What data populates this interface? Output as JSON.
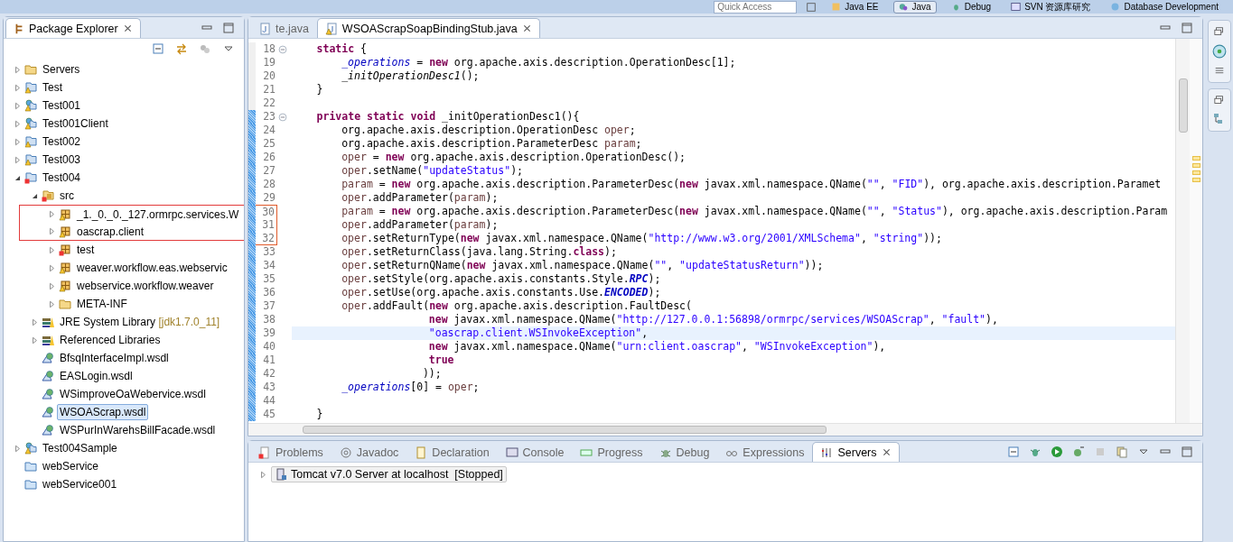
{
  "toolbar": {
    "quick_access": {
      "placeholder": "Quick Access"
    },
    "perspectives": [
      {
        "label": "Java EE",
        "selected": false,
        "kind": "jee"
      },
      {
        "label": "Java",
        "selected": true,
        "kind": "java"
      },
      {
        "label": "Debug",
        "selected": false,
        "kind": "debug"
      },
      {
        "label": "SVN 资源库研究",
        "selected": false,
        "kind": "svn"
      },
      {
        "label": "Database Development",
        "selected": false,
        "kind": "db"
      }
    ]
  },
  "explorer": {
    "title": "Package Explorer",
    "tree": [
      {
        "label": "Servers",
        "kind": "folder",
        "expanded": false,
        "boxed": false,
        "selected": false
      },
      {
        "label": "Test",
        "kind": "project",
        "expanded": false,
        "boxed": false,
        "selected": false
      },
      {
        "label": "Test001",
        "kind": "webproject",
        "expanded": false,
        "boxed": false,
        "selected": false
      },
      {
        "label": "Test001Client",
        "kind": "webproject",
        "expanded": false,
        "boxed": false,
        "selected": false
      },
      {
        "label": "Test002",
        "kind": "project",
        "expanded": false,
        "boxed": false,
        "selected": false
      },
      {
        "label": "Test003",
        "kind": "project",
        "expanded": false,
        "boxed": false,
        "selected": false
      },
      {
        "label": "Test004",
        "kind": "errproject",
        "expanded": true,
        "boxed": false,
        "selected": false,
        "children": [
          {
            "label": "src",
            "kind": "src",
            "expanded": true,
            "boxed": false,
            "selected": false,
            "children": [
              {
                "label": "_1._0._0._127.ormrpc.services.W",
                "kind": "package",
                "expanded": false,
                "boxed": true,
                "selected": false
              },
              {
                "label": "oascrap.client",
                "kind": "package",
                "expanded": false,
                "boxed": true,
                "selected": false
              },
              {
                "label": "test",
                "kind": "errpackage",
                "expanded": false,
                "boxed": false,
                "selected": false
              },
              {
                "label": "weaver.workflow.eas.webservic",
                "kind": "package",
                "expanded": false,
                "boxed": false,
                "selected": false
              },
              {
                "label": "webservice.workflow.weaver",
                "kind": "package",
                "expanded": false,
                "boxed": false,
                "selected": false
              },
              {
                "label": "META-INF",
                "kind": "folder",
                "expanded": false,
                "boxed": false,
                "selected": false
              }
            ]
          },
          {
            "label": "JRE System Library",
            "detail": "[jdk1.7.0_11]",
            "kind": "library",
            "expanded": false,
            "boxed": false,
            "selected": false
          },
          {
            "label": "Referenced Libraries",
            "kind": "library",
            "expanded": false,
            "boxed": false,
            "selected": false
          },
          {
            "label": "BfsqInterfaceImpl.wsdl",
            "kind": "wsdl",
            "boxed": false,
            "selected": false
          },
          {
            "label": "EASLogin.wsdl",
            "kind": "wsdl",
            "boxed": false,
            "selected": false
          },
          {
            "label": "WSimproveOaWebervice.wsdl",
            "kind": "wsdl",
            "boxed": false,
            "selected": false
          },
          {
            "label": "WSOAScrap.wsdl",
            "kind": "wsdl",
            "boxed": false,
            "selected": true
          },
          {
            "label": "WSPurInWarehsBillFacade.wsdl",
            "kind": "wsdl",
            "boxed": false,
            "selected": false
          }
        ]
      },
      {
        "label": "Test004Sample",
        "kind": "webproject",
        "expanded": false,
        "boxed": false,
        "selected": false
      },
      {
        "label": "webService",
        "kind": "plainfolder",
        "boxed": false,
        "selected": false
      },
      {
        "label": "webService001",
        "kind": "plainfolder",
        "boxed": false,
        "selected": false
      }
    ]
  },
  "editor": {
    "tabs": [
      {
        "label": "te.java",
        "selected": false,
        "warning": false
      },
      {
        "label": "WSOAScrapSoapBindingStub.java",
        "selected": true,
        "warning": true
      }
    ],
    "lines": [
      {
        "number": "18",
        "fold": true,
        "changed": false,
        "current": false,
        "boxed": false,
        "kind": "member",
        "tokens": [
          {
            "kind": "kw",
            "text": "static"
          },
          {
            "kind": "p",
            "text": " {"
          }
        ]
      },
      {
        "number": "19",
        "fold": false,
        "changed": false,
        "current": false,
        "boxed": false,
        "kind": "body",
        "tokens": [
          {
            "kind": "f",
            "text": "_operations"
          },
          {
            "kind": "p",
            "text": " = "
          },
          {
            "kind": "kw",
            "text": "new"
          },
          {
            "kind": "p",
            "text": " org.apache.axis.description.OperationDesc[1];"
          }
        ]
      },
      {
        "number": "20",
        "fold": false,
        "changed": false,
        "current": false,
        "boxed": false,
        "kind": "body",
        "tokens": [
          {
            "kind": "m",
            "text": "_initOperationDesc1"
          },
          {
            "kind": "p",
            "text": "();"
          }
        ]
      },
      {
        "number": "21",
        "fold": false,
        "changed": false,
        "current": false,
        "boxed": false,
        "kind": "member",
        "tokens": [
          {
            "kind": "p",
            "text": "}"
          }
        ]
      },
      {
        "number": "22",
        "fold": false,
        "changed": false,
        "current": false,
        "boxed": false,
        "kind": "member"
      },
      {
        "number": "23",
        "fold": true,
        "changed": true,
        "current": false,
        "boxed": false,
        "kind": "member",
        "tokens": [
          {
            "kind": "kw",
            "text": "private"
          },
          {
            "kind": "kw",
            "text": " static"
          },
          {
            "kind": "kw",
            "text": " void"
          },
          {
            "kind": "p",
            "text": " _initOperationDesc1(){"
          }
        ]
      },
      {
        "number": "24",
        "fold": false,
        "changed": true,
        "current": false,
        "boxed": false,
        "kind": "body",
        "tokens": [
          {
            "kind": "p",
            "text": "org.apache.axis.description.OperationDesc "
          },
          {
            "kind": "v",
            "text": "oper"
          },
          {
            "kind": "p",
            "text": ";"
          }
        ]
      },
      {
        "number": "25",
        "fold": false,
        "changed": true,
        "current": false,
        "boxed": false,
        "kind": "body",
        "tokens": [
          {
            "kind": "p",
            "text": "org.apache.axis.description.ParameterDesc "
          },
          {
            "kind": "v",
            "text": "param"
          },
          {
            "kind": "p",
            "text": ";"
          }
        ]
      },
      {
        "number": "26",
        "fold": false,
        "changed": true,
        "current": false,
        "boxed": false,
        "kind": "body",
        "tokens": [
          {
            "kind": "v",
            "text": "oper"
          },
          {
            "kind": "p",
            "text": " = "
          },
          {
            "kind": "kw",
            "text": "new"
          },
          {
            "kind": "p",
            "text": " org.apache.axis.description.OperationDesc();"
          }
        ]
      },
      {
        "number": "27",
        "fold": false,
        "changed": true,
        "current": false,
        "boxed": false,
        "kind": "body",
        "tokens": [
          {
            "kind": "v",
            "text": "oper"
          },
          {
            "kind": "p",
            "text": ".setName("
          },
          {
            "kind": "s",
            "text": "\"updateStatus\""
          },
          {
            "kind": "p",
            "text": ");"
          }
        ]
      },
      {
        "number": "28",
        "fold": false,
        "changed": true,
        "current": false,
        "boxed": false,
        "kind": "body",
        "tokens": [
          {
            "kind": "v",
            "text": "param"
          },
          {
            "kind": "p",
            "text": " = "
          },
          {
            "kind": "kw",
            "text": "new"
          },
          {
            "kind": "p",
            "text": " org.apache.axis.description.ParameterDesc("
          },
          {
            "kind": "kw",
            "text": "new"
          },
          {
            "kind": "p",
            "text": " javax.xml.namespace.QName("
          },
          {
            "kind": "s",
            "text": "\"\""
          },
          {
            "kind": "p",
            "text": ", "
          },
          {
            "kind": "s",
            "text": "\"FID\""
          },
          {
            "kind": "p",
            "text": "), org.apache.axis.description.Paramet"
          }
        ]
      },
      {
        "number": "29",
        "fold": false,
        "changed": true,
        "current": false,
        "boxed": false,
        "kind": "body",
        "tokens": [
          {
            "kind": "v",
            "text": "oper"
          },
          {
            "kind": "p",
            "text": ".addParameter("
          },
          {
            "kind": "v",
            "text": "param"
          },
          {
            "kind": "p",
            "text": ");"
          }
        ]
      },
      {
        "number": "30",
        "fold": false,
        "changed": true,
        "current": false,
        "boxed": true,
        "kind": "body",
        "tokens": [
          {
            "kind": "v",
            "text": "param"
          },
          {
            "kind": "p",
            "text": " = "
          },
          {
            "kind": "kw",
            "text": "new"
          },
          {
            "kind": "p",
            "text": " org.apache.axis.description.ParameterDesc("
          },
          {
            "kind": "kw",
            "text": "new"
          },
          {
            "kind": "p",
            "text": " javax.xml.namespace.QName("
          },
          {
            "kind": "s",
            "text": "\"\""
          },
          {
            "kind": "p",
            "text": ", "
          },
          {
            "kind": "s",
            "text": "\"Status\""
          },
          {
            "kind": "p",
            "text": "), org.apache.axis.description.Param"
          }
        ]
      },
      {
        "number": "31",
        "fold": false,
        "changed": true,
        "current": false,
        "boxed": true,
        "kind": "body",
        "tokens": [
          {
            "kind": "v",
            "text": "oper"
          },
          {
            "kind": "p",
            "text": ".addParameter("
          },
          {
            "kind": "v",
            "text": "param"
          },
          {
            "kind": "p",
            "text": ");"
          }
        ]
      },
      {
        "number": "32",
        "fold": false,
        "changed": true,
        "current": false,
        "boxed": true,
        "kind": "body",
        "tokens": [
          {
            "kind": "v",
            "text": "oper"
          },
          {
            "kind": "p",
            "text": ".setReturnType("
          },
          {
            "kind": "kw",
            "text": "new"
          },
          {
            "kind": "p",
            "text": " javax.xml.namespace.QName("
          },
          {
            "kind": "s",
            "text": "\"http://www.w3.org/2001/XMLSchema\""
          },
          {
            "kind": "p",
            "text": ", "
          },
          {
            "kind": "s",
            "text": "\"string\""
          },
          {
            "kind": "p",
            "text": "));"
          }
        ]
      },
      {
        "number": "33",
        "fold": false,
        "changed": true,
        "current": false,
        "boxed": false,
        "kind": "body",
        "tokens": [
          {
            "kind": "v",
            "text": "oper"
          },
          {
            "kind": "p",
            "text": ".setReturnClass(java.lang.String."
          },
          {
            "kind": "kw",
            "text": "class"
          },
          {
            "kind": "p",
            "text": ");"
          }
        ]
      },
      {
        "number": "34",
        "fold": false,
        "changed": true,
        "current": false,
        "boxed": false,
        "kind": "body",
        "tokens": [
          {
            "kind": "v",
            "text": "oper"
          },
          {
            "kind": "p",
            "text": ".setReturnQName("
          },
          {
            "kind": "kw",
            "text": "new"
          },
          {
            "kind": "p",
            "text": " javax.xml.namespace.QName("
          },
          {
            "kind": "s",
            "text": "\"\""
          },
          {
            "kind": "p",
            "text": ", "
          },
          {
            "kind": "s",
            "text": "\"updateStatusReturn\""
          },
          {
            "kind": "p",
            "text": "));"
          }
        ]
      },
      {
        "number": "35",
        "fold": false,
        "changed": true,
        "current": false,
        "boxed": false,
        "kind": "body",
        "tokens": [
          {
            "kind": "v",
            "text": "oper"
          },
          {
            "kind": "p",
            "text": ".setStyle(org.apache.axis.constants.Style."
          },
          {
            "kind": "c",
            "text": "RPC"
          },
          {
            "kind": "p",
            "text": ");"
          }
        ]
      },
      {
        "number": "36",
        "fold": false,
        "changed": true,
        "current": false,
        "boxed": false,
        "kind": "body",
        "tokens": [
          {
            "kind": "v",
            "text": "oper"
          },
          {
            "kind": "p",
            "text": ".setUse(org.apache.axis.constants.Use."
          },
          {
            "kind": "c",
            "text": "ENCODED"
          },
          {
            "kind": "p",
            "text": ");"
          }
        ]
      },
      {
        "number": "37",
        "fold": false,
        "changed": true,
        "current": false,
        "boxed": false,
        "kind": "body",
        "tokens": [
          {
            "kind": "v",
            "text": "oper"
          },
          {
            "kind": "p",
            "text": ".addFault("
          },
          {
            "kind": "kw",
            "text": "new"
          },
          {
            "kind": "p",
            "text": " org.apache.axis.description.FaultDesc("
          }
        ]
      },
      {
        "number": "38",
        "fold": false,
        "changed": true,
        "current": false,
        "boxed": false,
        "kind": "argument",
        "tokens": [
          {
            "kind": "kw",
            "text": "new"
          },
          {
            "kind": "p",
            "text": " javax.xml.namespace.QName("
          },
          {
            "kind": "s",
            "text": "\"http://127.0.0.1:56898/ormrpc/services/WSOAScrap\""
          },
          {
            "kind": "p",
            "text": ", "
          },
          {
            "kind": "s",
            "text": "\"fault\""
          },
          {
            "kind": "p",
            "text": "),"
          }
        ]
      },
      {
        "number": "39",
        "fold": false,
        "changed": true,
        "current": true,
        "boxed": false,
        "kind": "argument",
        "tokens": [
          {
            "kind": "s",
            "text": "\"oascrap.client.WSInvokeException\""
          },
          {
            "kind": "p",
            "text": ","
          }
        ]
      },
      {
        "number": "40",
        "fold": false,
        "changed": true,
        "current": false,
        "boxed": false,
        "kind": "argument",
        "tokens": [
          {
            "kind": "kw",
            "text": "new"
          },
          {
            "kind": "p",
            "text": " javax.xml.namespace.QName("
          },
          {
            "kind": "s",
            "text": "\"urn:client.oascrap\""
          },
          {
            "kind": "p",
            "text": ", "
          },
          {
            "kind": "s",
            "text": "\"WSInvokeException\""
          },
          {
            "kind": "p",
            "text": "),"
          }
        ]
      },
      {
        "number": "41",
        "fold": false,
        "changed": true,
        "current": false,
        "boxed": false,
        "kind": "argument",
        "tokens": [
          {
            "kind": "kw",
            "text": "true"
          }
        ]
      },
      {
        "number": "42",
        "fold": false,
        "changed": true,
        "current": false,
        "boxed": false,
        "kind": "closing",
        "tokens": [
          {
            "kind": "p",
            "text": "));"
          }
        ]
      },
      {
        "number": "43",
        "fold": false,
        "changed": true,
        "current": false,
        "boxed": false,
        "kind": "body",
        "tokens": [
          {
            "kind": "f",
            "text": "_operations"
          },
          {
            "kind": "p",
            "text": "[0] = "
          },
          {
            "kind": "v",
            "text": "oper"
          },
          {
            "kind": "p",
            "text": ";"
          }
        ]
      },
      {
        "number": "44",
        "fold": false,
        "changed": true,
        "current": false,
        "boxed": false,
        "kind": "body"
      },
      {
        "number": "45",
        "fold": false,
        "changed": true,
        "current": false,
        "boxed": false,
        "kind": "member",
        "tokens": [
          {
            "kind": "p",
            "text": "}"
          }
        ]
      }
    ]
  },
  "bottom_panel": {
    "tabs": [
      {
        "label": "Problems",
        "kind": "problems",
        "selected": false
      },
      {
        "label": "Javadoc",
        "kind": "javadoc",
        "selected": false
      },
      {
        "label": "Declaration",
        "kind": "declaration",
        "selected": false
      },
      {
        "label": "Console",
        "kind": "console",
        "selected": false
      },
      {
        "label": "Progress",
        "kind": "progress",
        "selected": false
      },
      {
        "label": "Debug",
        "kind": "debug",
        "selected": false
      },
      {
        "label": "Expressions",
        "kind": "expressions",
        "selected": false
      },
      {
        "label": "Servers",
        "kind": "servers",
        "selected": true
      }
    ],
    "servers": [
      {
        "label": "Tomcat v7.0 Server at localhost  [Stopped]",
        "expanded": false
      }
    ]
  }
}
